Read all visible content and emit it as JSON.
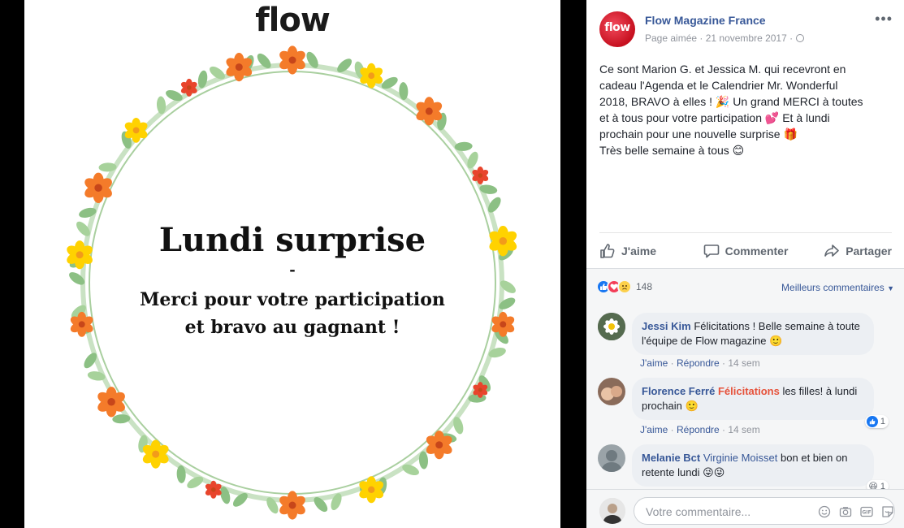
{
  "photo": {
    "logo": "flow",
    "title": "Lundi surprise",
    "dash": "-",
    "line1": "Merci pour votre participation",
    "line2": "et bravo au gagnant !"
  },
  "post": {
    "page_name": "Flow Magazine France",
    "avatar_text": "flow",
    "meta": "Page aimée · 21 novembre 2017 ·",
    "text_lines": [
      "Ce sont Marion G. et Jessica M. qui recevront en",
      "cadeau l'Agenda et le Calendrier Mr. Wonderful",
      "2018, BRAVO à elles ! 🎉 Un grand MERCI à toutes",
      "et à tous pour votre participation 💕 Et à lundi",
      "prochain pour une nouvelle surprise 🎁",
      "Très belle semaine à tous 😊"
    ]
  },
  "actions": {
    "like": "J'aime",
    "comment": "Commenter",
    "share": "Partager"
  },
  "reactions": {
    "count": "148",
    "sort_label": "Meilleurs commentaires"
  },
  "comments": [
    {
      "author": "Jessi Kim",
      "text": "Félicitations ! Belle semaine à toute l'équipe de Flow magazine 🙂",
      "like": "J'aime",
      "reply": "Répondre",
      "time": "14 sem"
    },
    {
      "author": "Florence Ferré",
      "tag": "Félicitations",
      "text": "les filles! à lundi prochain 🙂",
      "like": "J'aime",
      "reply": "Répondre",
      "time": "14 sem",
      "likes": "1"
    },
    {
      "author": "Melanie Bct",
      "tag": "Virginie Moisset",
      "text": "bon et bien on retente lundi 😜😜",
      "likes": "1"
    }
  ],
  "composer": {
    "placeholder": "Votre commentaire..."
  },
  "colors": {
    "link": "#385898",
    "brand_red": "#c6101f",
    "flower_orange": "#f47b2a",
    "flower_yellow": "#ffd200",
    "leaf_green": "#8cc084"
  }
}
